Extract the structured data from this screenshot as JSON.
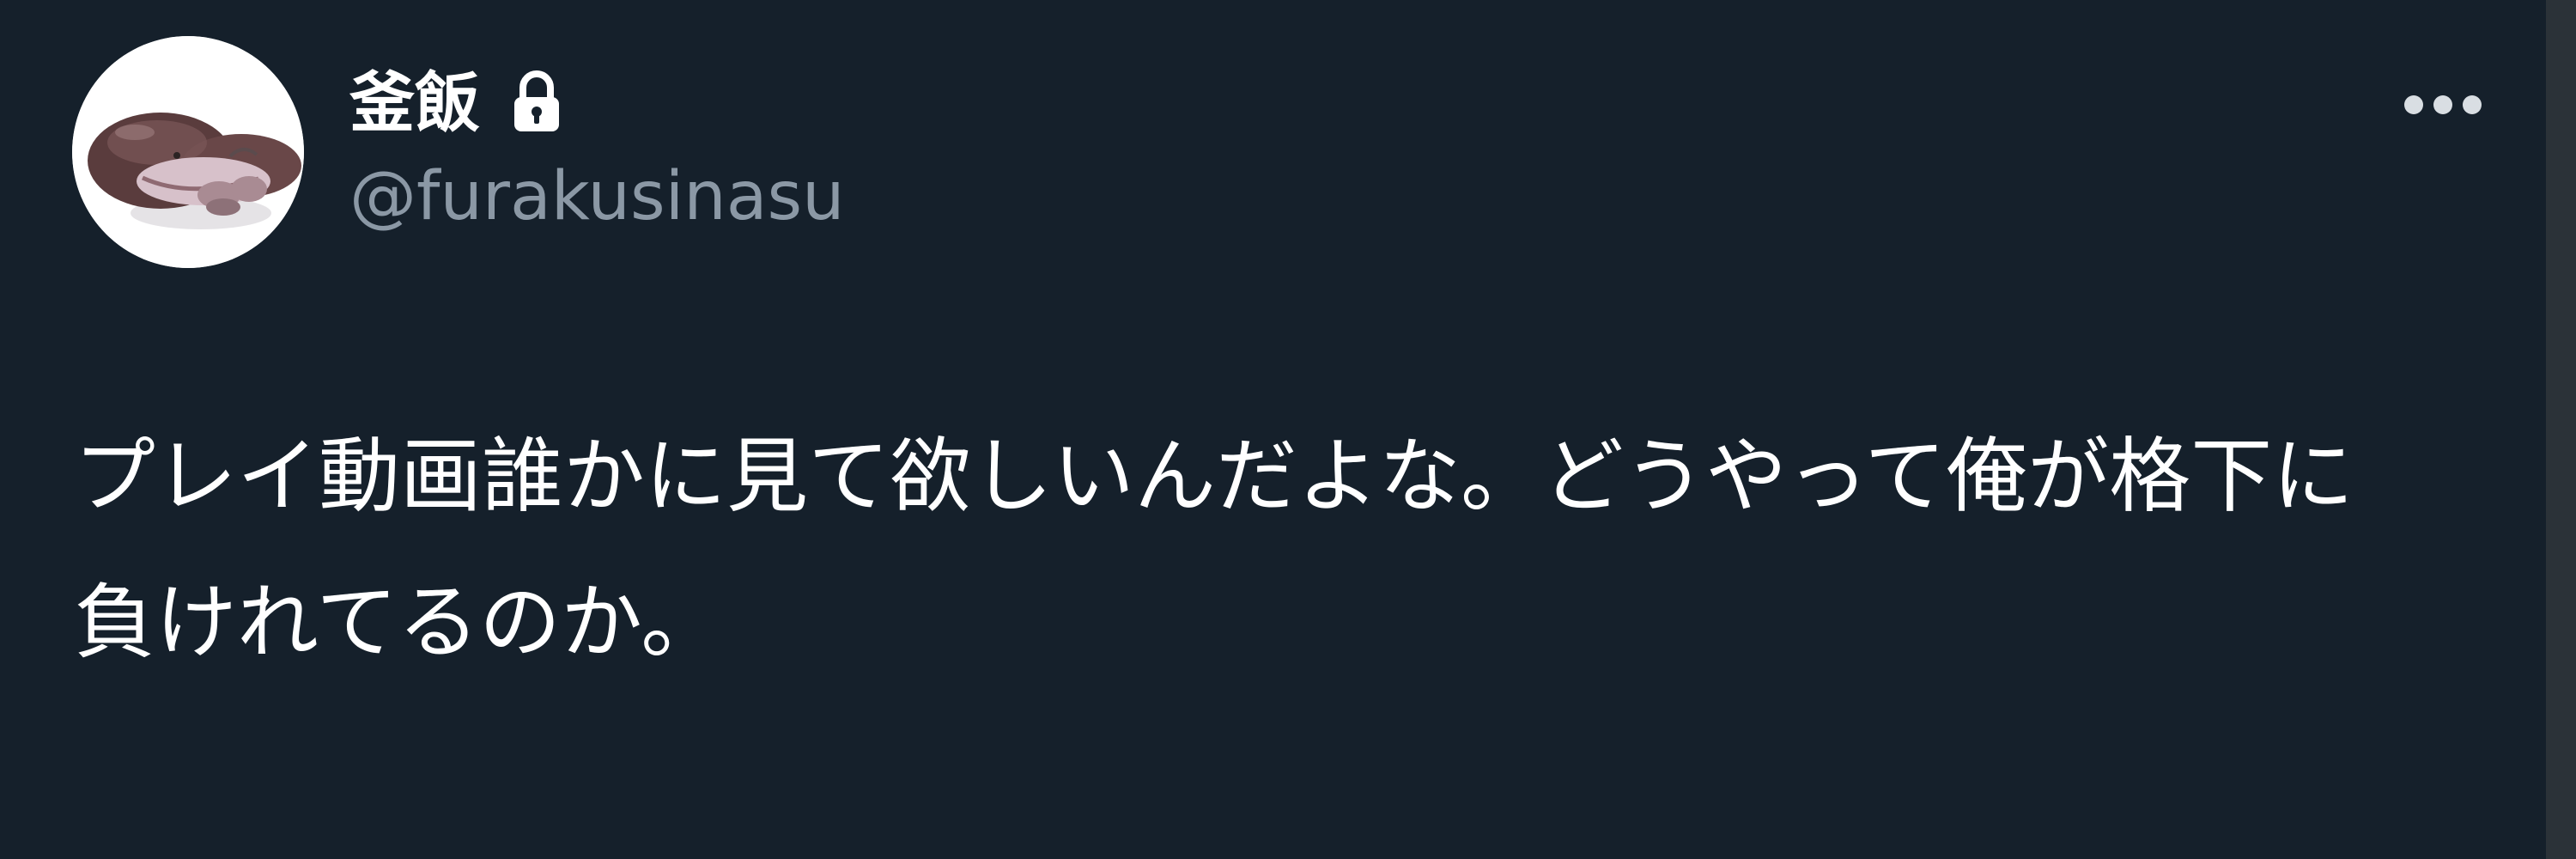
{
  "user": {
    "display_name": "釜飯",
    "username": "@furakusinasu",
    "avatar_icon": "creature-avatar-icon",
    "lock_icon": "lock-icon"
  },
  "tweet": {
    "lines": [
      "プレイ動画誰かに見て欲しいんだよな。どうやって俺が格下に",
      "負けれてるのか。"
    ]
  },
  "actions": {
    "more_icon": "more-dots-icon"
  },
  "colors": {
    "background": "#15202b",
    "primary_text": "#ffffff",
    "secondary_text": "#8b98a5",
    "edge": "#2b3238"
  }
}
